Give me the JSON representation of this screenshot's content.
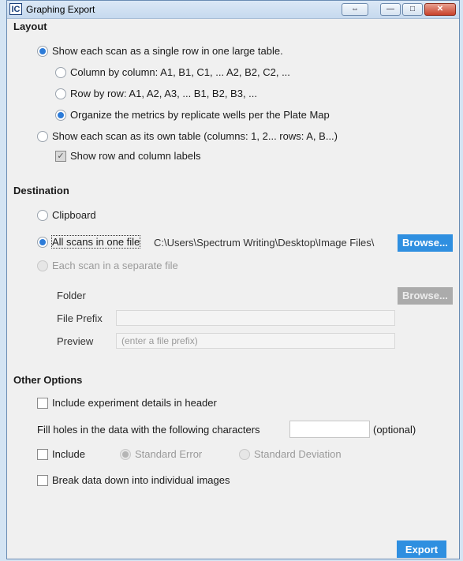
{
  "window": {
    "app_icon": "IC",
    "title": "Graphing Export",
    "buttons": {
      "restore": "⇔",
      "minimize": "—",
      "maximize": "□",
      "close": "✕"
    }
  },
  "layout": {
    "heading": "Layout",
    "single_row": "Show each scan as a single row in one large table.",
    "col_by_col": "Column by column: A1, B1, C1, ... A2, B2, C2, ...",
    "row_by_row": "Row by row: A1, A2,  A3, ... B1, B2, B3, ...",
    "organize": "Organize the metrics by replicate wells per the Plate Map",
    "own_table": "Show each scan as its own table  (columns: 1, 2...  rows: A, B...)",
    "show_labels": "Show row and column labels"
  },
  "destination": {
    "heading": "Destination",
    "clipboard": "Clipboard",
    "all_in_one": "All scans in one file",
    "path": "C:\\Users\\Spectrum Writing\\Desktop\\Image Files\\",
    "browse": "Browse...",
    "separate": "Each scan in a separate file",
    "folder_label": "Folder",
    "browse_disabled": "Browse...",
    "prefix_label": "File Prefix",
    "prefix_value": "",
    "preview_label": "Preview",
    "preview_placeholder": "(enter a file prefix)"
  },
  "other": {
    "heading": "Other Options",
    "include_details": "Include experiment details in header",
    "fill_holes": "Fill holes in the data with the following characters",
    "fill_value": "",
    "optional": "(optional)",
    "include": "Include",
    "std_error": "Standard Error",
    "std_dev": "Standard Deviation",
    "break_down": "Break data down into individual images"
  },
  "footer": {
    "export": "Export"
  },
  "colors": {
    "accent": "#2f8fe0",
    "disabled_button": "#ababab"
  }
}
